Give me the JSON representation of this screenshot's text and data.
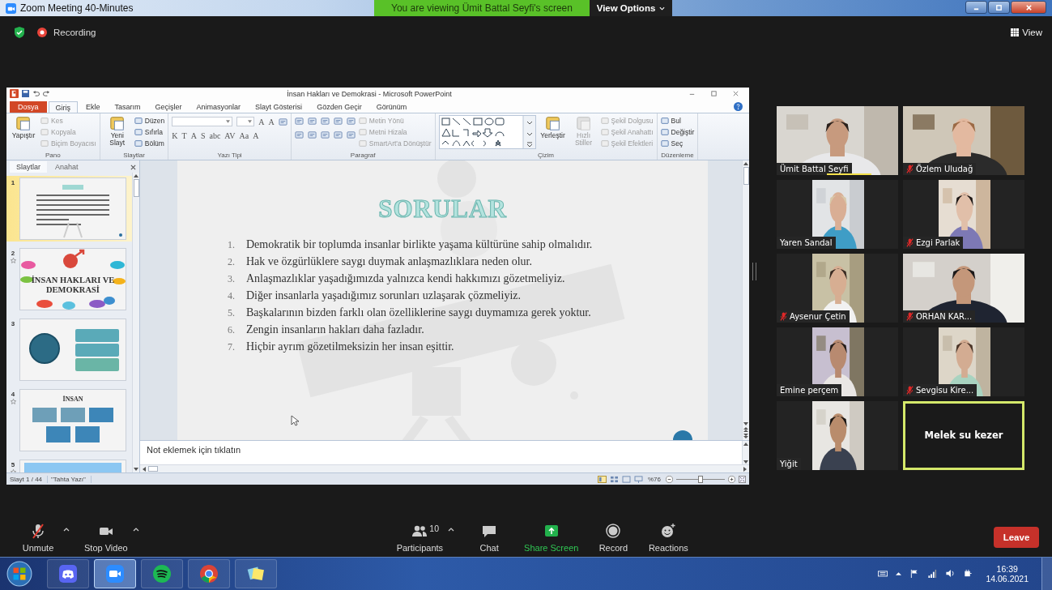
{
  "window": {
    "title": "Zoom Meeting 40-Minutes"
  },
  "share_banner": "You are viewing Ümit Battal Seyfi's screen",
  "view_options": "View Options",
  "meeting_bar": {
    "recording": "Recording",
    "view": "View"
  },
  "powerpoint": {
    "title": "İnsan Hakları ve Demokrasi - Microsoft PowerPoint",
    "tabs": [
      {
        "label": "Dosya",
        "kind": "file",
        "selected": false
      },
      {
        "label": "Giriş",
        "kind": "tab",
        "selected": true
      },
      {
        "label": "Ekle",
        "kind": "tab",
        "selected": false
      },
      {
        "label": "Tasarım",
        "kind": "tab",
        "selected": false
      },
      {
        "label": "Geçişler",
        "kind": "tab",
        "selected": false
      },
      {
        "label": "Animasyonlar",
        "kind": "tab",
        "selected": false
      },
      {
        "label": "Slayt Gösterisi",
        "kind": "tab",
        "selected": false
      },
      {
        "label": "Gözden Geçir",
        "kind": "tab",
        "selected": false
      },
      {
        "label": "Görünüm",
        "kind": "tab",
        "selected": false
      }
    ],
    "ribbon": [
      {
        "name": "Pano",
        "kind": "plain",
        "large": [
          {
            "label": "Yapıştır",
            "disabled": false
          }
        ],
        "small": [
          {
            "label": "Kes",
            "disabled": true
          },
          {
            "label": "Kopyala",
            "disabled": true
          },
          {
            "label": "Biçim Boyacısı",
            "disabled": true
          }
        ]
      },
      {
        "name": "Slaytlar",
        "kind": "plain",
        "large": [
          {
            "label": "Yeni Slayt",
            "disabled": false
          }
        ],
        "small": [
          {
            "label": "Düzen",
            "disabled": false
          },
          {
            "label": "Sıfırla",
            "disabled": false
          },
          {
            "label": "Bölüm",
            "disabled": false
          }
        ]
      },
      {
        "name": "Yazı Tipi",
        "kind": "font",
        "size_buttons": [
          "A",
          "A"
        ],
        "format_buttons": [
          "K",
          "T",
          "A",
          "S",
          "abc",
          "AV",
          "Aa",
          "A"
        ]
      },
      {
        "name": "Paragraf",
        "kind": "paragraph",
        "small": [
          {
            "label": "Metin Yönü",
            "disabled": true
          },
          {
            "label": "Metni Hizala",
            "disabled": true
          },
          {
            "label": "SmartArt'a Dönüştür",
            "disabled": true
          }
        ]
      },
      {
        "name": "Çizim",
        "kind": "drawing",
        "large": [
          {
            "label": "Yerleştir",
            "disabled": false
          },
          {
            "label": "Hızlı Stiller",
            "disabled": true
          }
        ],
        "small": [
          {
            "label": "Şekil Dolgusu",
            "disabled": true
          },
          {
            "label": "Şekil Anahattı",
            "disabled": true
          },
          {
            "label": "Şekil Efektleri",
            "disabled": true
          }
        ]
      },
      {
        "name": "Düzenleme",
        "kind": "plain",
        "small": [
          {
            "label": "Bul",
            "disabled": false
          },
          {
            "label": "Değiştir",
            "disabled": false
          },
          {
            "label": "Seç",
            "disabled": false
          }
        ]
      }
    ],
    "pane_tabs": [
      {
        "label": "Slaytlar",
        "selected": true
      },
      {
        "label": "Anahat",
        "selected": false
      }
    ],
    "thumbnails": [
      {
        "number": "1",
        "kind": "questions",
        "selected": true,
        "transition": false
      },
      {
        "number": "2",
        "kind": "title",
        "title": "İNSAN HAKLARI VE DEMOKRASİ",
        "selected": false,
        "transition": true
      },
      {
        "number": "3",
        "kind": "diagram",
        "selected": false,
        "transition": false
      },
      {
        "number": "4",
        "kind": "chart",
        "title": "İNSAN",
        "selected": false,
        "transition": true
      },
      {
        "number": "5",
        "kind": "picture",
        "selected": false,
        "transition": true
      }
    ],
    "slide": {
      "title": "SORULAR",
      "items": [
        {
          "number": "1.",
          "text": "Demokratik bir toplumda insanlar birlikte yaşama kültürüne sahip olmalıdır."
        },
        {
          "number": "2.",
          "text": "Hak ve özgürlüklere saygı duymak anlaşmazlıklara neden olur."
        },
        {
          "number": "3.",
          "text": "Anlaşmazlıklar yaşadığımızda yalnızca kendi hakkımızı gözetmeliyiz."
        },
        {
          "number": "4.",
          "text": "Diğer insanlarla yaşadığımız sorunları uzlaşarak çözmeliyiz."
        },
        {
          "number": "5.",
          "text": "Başkalarının bizden farklı olan özelliklerine saygı duymamıza gerek yoktur."
        },
        {
          "number": "6.",
          "text": "Zengin insanların hakları daha fazladır."
        },
        {
          "number": "7.",
          "text": "Hiçbir ayrım gözetilmeksizin her insan eşittir."
        }
      ]
    },
    "notes": {
      "placeholder": "Not eklemek için tıklatın"
    },
    "status": {
      "slide": "Slayt 1 / 44",
      "theme": "\"Tahta Yazı\"",
      "zoom": "%76"
    },
    "zoom_slider": {
      "level": 0.5
    }
  },
  "participants": [
    {
      "name": "Ümit Battal Seyfi",
      "kind": "wide",
      "muted": false,
      "speaking": false,
      "sharing": true
    },
    {
      "name": "Özlem Uludağ",
      "kind": "wide",
      "muted": true,
      "speaking": false,
      "sharing": false
    },
    {
      "name": "Yaren Sandal",
      "kind": "portrait",
      "muted": false,
      "speaking": false,
      "sharing": false
    },
    {
      "name": "Ezgi Parlak",
      "kind": "portrait",
      "muted": true,
      "speaking": false,
      "sharing": false
    },
    {
      "name": "Aysenur Çetin",
      "kind": "portrait",
      "muted": true,
      "speaking": false,
      "sharing": false
    },
    {
      "name": "ORHAN KAR...",
      "kind": "wide",
      "muted": true,
      "speaking": false,
      "sharing": false
    },
    {
      "name": "Emine perçem",
      "kind": "portrait",
      "muted": false,
      "speaking": false,
      "sharing": false
    },
    {
      "name": "Sevgisu Kire...",
      "kind": "portrait",
      "muted": true,
      "speaking": false,
      "sharing": false
    },
    {
      "name": "Yiğit",
      "kind": "portrait",
      "muted": false,
      "speaking": false,
      "sharing": false
    },
    {
      "name": "Melek su kezer",
      "kind": "name",
      "muted": false,
      "speaking": true,
      "sharing": false
    }
  ],
  "toolbar": [
    {
      "label": "Unmute",
      "kind": "audio",
      "menu": true
    },
    {
      "label": "Stop Video",
      "kind": "video",
      "menu": true
    },
    {
      "label": "Participants",
      "kind": "participants",
      "count": "10",
      "menu": true
    },
    {
      "label": "Chat",
      "kind": "chat",
      "menu": false
    },
    {
      "label": "Share Screen",
      "kind": "share",
      "menu": false
    },
    {
      "label": "Record",
      "kind": "record",
      "menu": false
    },
    {
      "label": "Reactions",
      "kind": "reactions",
      "menu": false
    }
  ],
  "leave": "Leave",
  "taskbar": {
    "apps": [
      {
        "kind": "chat",
        "selected": false
      },
      {
        "kind": "video",
        "selected": true
      },
      {
        "kind": "music",
        "selected": false
      },
      {
        "kind": "browser",
        "selected": false
      },
      {
        "kind": "notes",
        "selected": false
      }
    ],
    "time": "16:39",
    "date": "14.06.2021"
  }
}
